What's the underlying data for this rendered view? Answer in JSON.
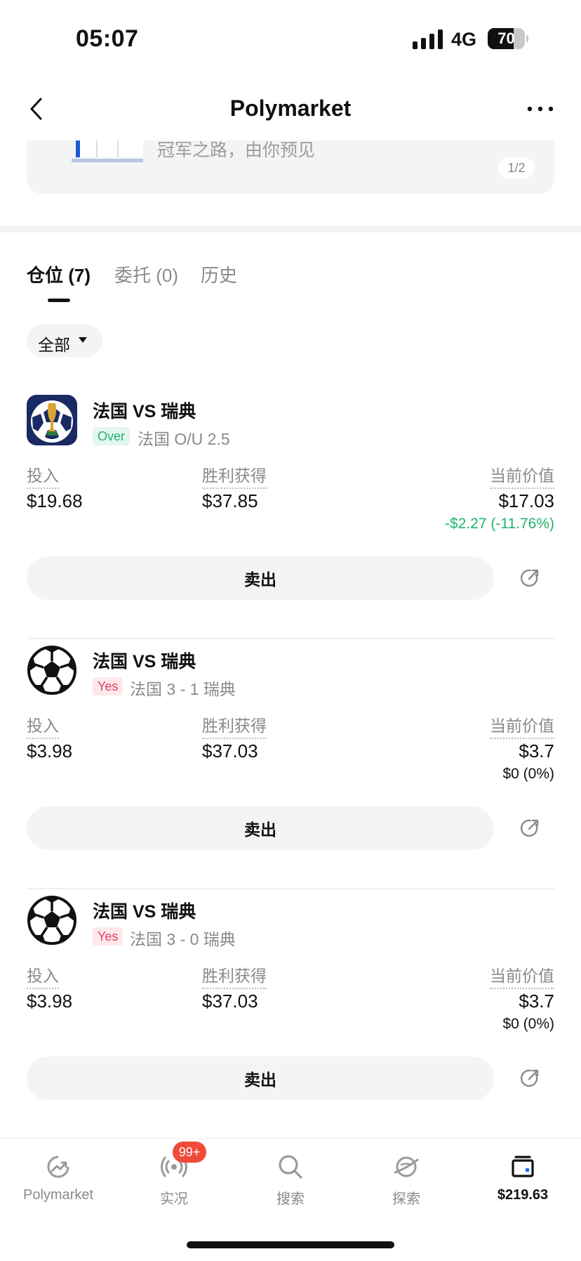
{
  "status_bar": {
    "time": "05:07",
    "network": "4G",
    "battery": "70",
    "battery_level": 0.7
  },
  "nav": {
    "title": "Polymarket",
    "back_icon": "chevron-left-icon",
    "more_icon": "ellipsis-icon"
  },
  "banner": {
    "text": "冠军之路，由你预见",
    "page_indicator": "1/2"
  },
  "tabs": [
    {
      "label": "仓位 (7)",
      "active": true
    },
    {
      "label": "委托 (0)",
      "active": false
    },
    {
      "label": "历史",
      "active": false
    }
  ],
  "filter": {
    "label": "全部"
  },
  "labels": {
    "invested": "投入",
    "to_win": "胜利获得",
    "current_value": "当前价值",
    "sell": "卖出"
  },
  "positions": [
    {
      "title": "法国 VS 瑞典",
      "outcome": "Over",
      "market": "法国 O/U 2.5",
      "invested": "$19.68",
      "to_win": "$37.85",
      "current_value": "$17.03",
      "pnl": "-$2.27 (-11.76%)",
      "icon": "world-cup-icon"
    },
    {
      "title": "法国 VS 瑞典",
      "outcome": "Yes",
      "market": "法国 3 - 1 瑞典",
      "invested": "$3.98",
      "to_win": "$37.03",
      "current_value": "$3.7",
      "pnl": "$0 (0%)",
      "icon": "soccer-ball-icon"
    },
    {
      "title": "法国 VS 瑞典",
      "outcome": "Yes",
      "market": "法国 3 - 0 瑞典",
      "invested": "$3.98",
      "to_win": "$37.03",
      "current_value": "$3.7",
      "pnl": "$0 (0%)",
      "icon": "soccer-ball-icon"
    }
  ],
  "tabbar": {
    "items": [
      {
        "label": "Polymarket",
        "icon": "polymarket-logo-icon",
        "active": false
      },
      {
        "label": "实况",
        "icon": "live-broadcast-icon",
        "active": false,
        "badge": "99+"
      },
      {
        "label": "搜索",
        "icon": "search-icon",
        "active": false
      },
      {
        "label": "探索",
        "icon": "explore-planet-icon",
        "active": false
      },
      {
        "label": "$219.63",
        "icon": "wallet-icon",
        "active": true
      }
    ]
  },
  "colors": {
    "positive_green": "#21b36c",
    "yes_red": "#e2405f",
    "badge_red": "#f04a3a",
    "pill_gray": "#f3f4f5"
  }
}
